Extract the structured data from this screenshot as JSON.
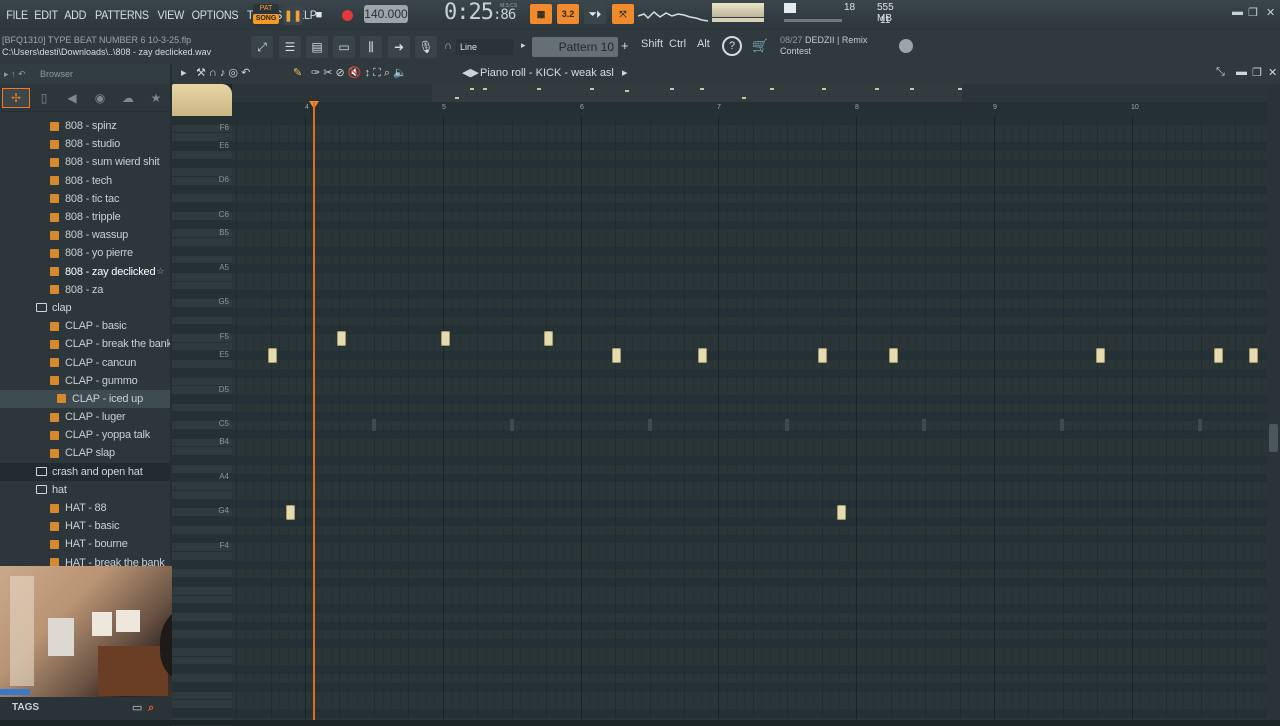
{
  "menu": [
    "FILE",
    "EDIT",
    "ADD",
    "PATTERNS",
    "VIEW",
    "OPTIONS",
    "TOOLS",
    "HELP"
  ],
  "transport": {
    "pat": "PAT",
    "song": "SONG",
    "tempo": "140.000",
    "time": "0:25",
    "time_sub": ":86",
    "time_unit": "M:S:CS"
  },
  "cpu": {
    "voices": "18",
    "ram": "555 MB",
    "poly": "11"
  },
  "hint": {
    "line1": "[BFQ1310] TYPE BEAT NUMBER 6 10-3-25.flp",
    "line2": "C:\\Users\\desti\\Downloads\\..\\808 - zay declicked.wav"
  },
  "toolbar": {
    "snap": "Line",
    "pattern": "Pattern 10",
    "shift": "Shift",
    "ctrl": "Ctrl",
    "alt": "Alt"
  },
  "news": {
    "date": "08/27",
    "text1": "DEDZII | Remix",
    "text2": "Contest"
  },
  "browser": {
    "title": "Browser",
    "items": [
      {
        "label": "808 - spinz",
        "type": "file"
      },
      {
        "label": "808 - studio",
        "type": "file"
      },
      {
        "label": "808 - sum wierd shit",
        "type": "file"
      },
      {
        "label": "808 - tech",
        "type": "file"
      },
      {
        "label": "808 - tic tac",
        "type": "file"
      },
      {
        "label": "808 - tripple",
        "type": "file"
      },
      {
        "label": "808 - wassup",
        "type": "file"
      },
      {
        "label": "808 - yo pierre",
        "type": "file"
      },
      {
        "label": "808 - zay declicked",
        "type": "file",
        "state": "hi"
      },
      {
        "label": "808 - za",
        "type": "file"
      },
      {
        "label": "clap",
        "type": "folder"
      },
      {
        "label": "CLAP - basic",
        "type": "file"
      },
      {
        "label": "CLAP - break the bank",
        "type": "file"
      },
      {
        "label": "CLAP - cancun",
        "type": "file"
      },
      {
        "label": "CLAP - gummo",
        "type": "file"
      },
      {
        "label": "CLAP - iced up",
        "type": "file",
        "state": "sel"
      },
      {
        "label": "CLAP - luger",
        "type": "file"
      },
      {
        "label": "CLAP - yoppa talk",
        "type": "file"
      },
      {
        "label": "CLAP slap",
        "type": "file"
      },
      {
        "label": "crash and open hat",
        "type": "folder",
        "state": "dark"
      },
      {
        "label": "hat",
        "type": "folder"
      },
      {
        "label": "HAT - 88",
        "type": "file"
      },
      {
        "label": "HAT - basic",
        "type": "file"
      },
      {
        "label": "HAT - bourne",
        "type": "file"
      },
      {
        "label": "HAT - break the bank",
        "type": "file"
      }
    ],
    "tags_label": "TAGS"
  },
  "piano_roll": {
    "title": "Piano roll - KICK - weak asl",
    "bars": [
      "4",
      "5",
      "6",
      "7",
      "8",
      "9",
      "10"
    ],
    "key_labels": [
      "F6",
      "E6",
      "D6",
      "C6",
      "B5",
      "A5",
      "G5",
      "F5",
      "E5",
      "D5",
      "C5",
      "B4",
      "A4",
      "G4",
      "F4"
    ]
  }
}
